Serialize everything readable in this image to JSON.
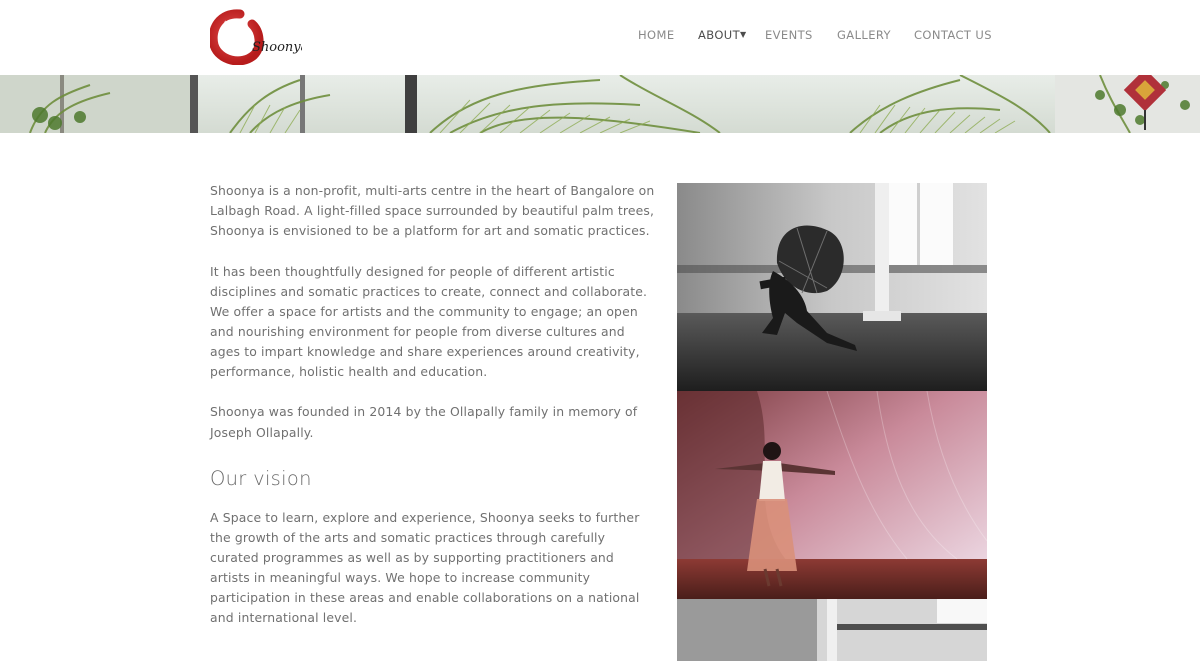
{
  "brand": {
    "logo_text": "Shoonya",
    "accent": "#c62828"
  },
  "nav": {
    "items": [
      {
        "label": "HOME",
        "active": false
      },
      {
        "label": "ABOUT",
        "active": true
      },
      {
        "label": "EVENTS",
        "active": false
      },
      {
        "label": "GALLERY",
        "active": false
      },
      {
        "label": "CONTACT US",
        "active": false
      }
    ],
    "dropdown_glyph": "▼"
  },
  "content": {
    "paragraphs": [
      "Shoonya is a non-profit, multi-arts centre in the heart of Bangalore on Lalbagh Road. A light-filled space surrounded by beautiful palm trees, Shoonya is envisioned to be a platform for art and somatic practices.",
      "It has been thoughtfully designed for people of different artistic disciplines and somatic practices to create, connect and collaborate. We offer a space for artists and the community to engage; an open and nourishing environment for people from diverse cultures and ages to impart knowledge and share experiences around creativity, performance, holistic health and education.",
      "Shoonya was founded in 2014 by the Ollapally family in memory of Joseph Ollapally."
    ],
    "vision_heading": "Our vision",
    "vision_text": "A Space to learn, explore and experience, Shoonya seeks to further the growth of the arts and somatic practices through carefully curated programmes as well as by supporting practitioners and artists in meaningful ways. We hope to increase community participation in these areas and enable collaborations on a national and international level."
  },
  "icons": {
    "logo": "enso-circle-logo",
    "caret": "chevron-down-icon"
  }
}
